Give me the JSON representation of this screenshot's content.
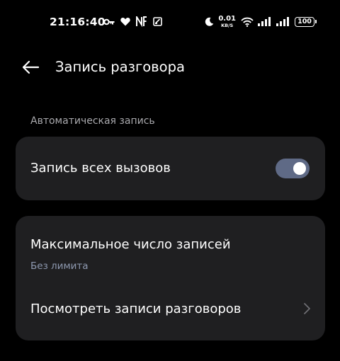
{
  "status_bar": {
    "time": "21:16:40",
    "net_speed_value": "0.01",
    "net_speed_unit": "KB/S",
    "battery": "100",
    "left_icons": [
      "key-icon",
      "heart-icon",
      "nfc-icon",
      "screenshot-icon"
    ],
    "right_icons": [
      "moon-icon",
      "wifi-icon",
      "signal-icon",
      "signal-icon",
      "battery-icon"
    ]
  },
  "app_bar": {
    "back_icon": "arrow-left-icon",
    "title": "Запись разговора"
  },
  "section": {
    "header": "Автоматическая запись"
  },
  "auto_record": {
    "label": "Запись всех вызовов",
    "toggle_on": true
  },
  "settings": {
    "max_records_label": "Максимальное число записей",
    "max_records_value": "Без лимита",
    "view_records_label": "Посмотреть записи разговоров",
    "chevron_icon": "chevron-right-icon"
  },
  "colors": {
    "background": "#000000",
    "card": "#1f1f21",
    "section_header": "#a9a9ad",
    "subtitle": "#8e99b0",
    "toggle_track": "#5f6a86"
  }
}
